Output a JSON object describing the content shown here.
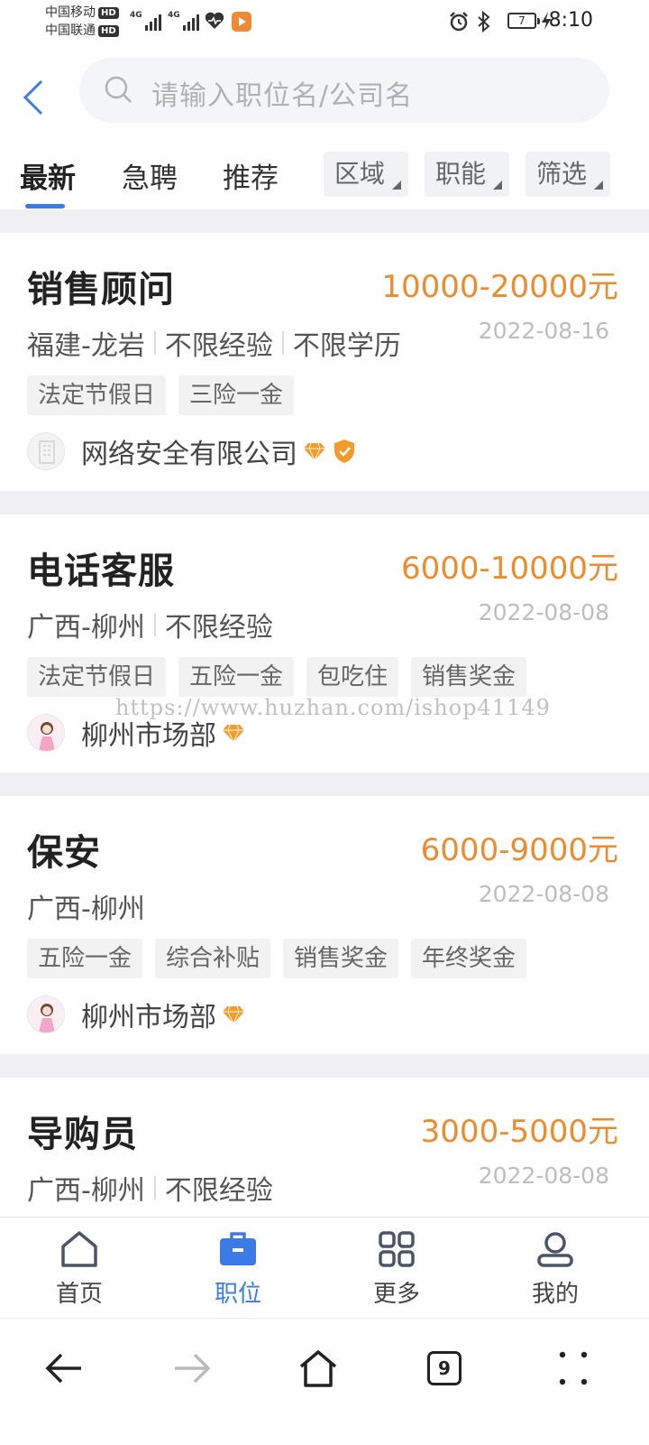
{
  "status_bar": {
    "carrier1": "中国移动",
    "carrier2": "中国联通",
    "hd": "HD",
    "network": "4G",
    "battery": "7",
    "time": "8:10"
  },
  "search": {
    "placeholder": "请输入职位名/公司名"
  },
  "tabs": [
    {
      "label": "最新"
    },
    {
      "label": "急聘"
    },
    {
      "label": "推荐"
    }
  ],
  "filters": [
    {
      "label": "区域"
    },
    {
      "label": "职能"
    },
    {
      "label": "筛选"
    }
  ],
  "jobs": [
    {
      "title": "销售顾问",
      "salary": "10000-20000元",
      "location": "福建-龙岩",
      "experience": "不限经验",
      "education": "不限学历",
      "date": "2022-08-16",
      "tags": [
        "法定节假日",
        "三险一金"
      ],
      "company": "网络安全有限公司"
    },
    {
      "title": "电话客服",
      "salary": "6000-10000元",
      "location": "广西-柳州",
      "experience": "不限经验",
      "date": "2022-08-08",
      "tags": [
        "法定节假日",
        "五险一金",
        "包吃住",
        "销售奖金"
      ],
      "company": "柳州市场部"
    },
    {
      "title": "保安",
      "salary": "6000-9000元",
      "location": "广西-柳州",
      "date": "2022-08-08",
      "tags": [
        "五险一金",
        "综合补贴",
        "销售奖金",
        "年终奖金"
      ],
      "company": "柳州市场部"
    },
    {
      "title": "导购员",
      "salary": "3000-5000元",
      "location": "广西-柳州",
      "experience": "不限经验",
      "date": "2022-08-08"
    }
  ],
  "bottom_nav": [
    {
      "label": "首页",
      "icon": "home-icon"
    },
    {
      "label": "职位",
      "icon": "briefcase-icon"
    },
    {
      "label": "更多",
      "icon": "grid-icon"
    },
    {
      "label": "我的",
      "icon": "user-icon"
    }
  ],
  "system_nav": {
    "tab_count": "9"
  },
  "watermark": "https://www.huzhan.com/ishop41149",
  "colors": {
    "accent": "#3b7be6",
    "salary": "#ee8c2d",
    "badge": "#f39c2b"
  }
}
